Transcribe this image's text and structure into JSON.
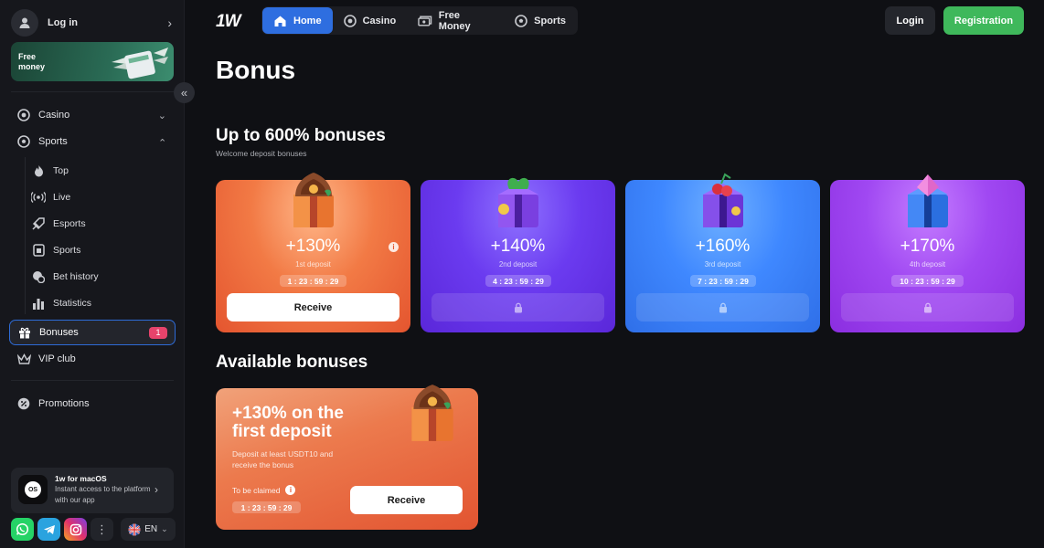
{
  "sidebar": {
    "login_label": "Log in",
    "free_money": "Free money",
    "nav": [
      {
        "label": "Casino",
        "icon": "casino-chip-icon"
      },
      {
        "label": "Sports",
        "icon": "soccer-ball-icon"
      }
    ],
    "sports_sub": [
      {
        "label": "Top",
        "icon": "fire-icon"
      },
      {
        "label": "Live",
        "icon": "broadcast-icon"
      },
      {
        "label": "Esports",
        "icon": "esports-icon"
      },
      {
        "label": "Sports",
        "icon": "sports-icon"
      },
      {
        "label": "Bet history",
        "icon": "bet-history-icon"
      },
      {
        "label": "Statistics",
        "icon": "bar-chart-icon"
      }
    ],
    "bonuses": {
      "label": "Bonuses",
      "badge": "1"
    },
    "vip": "VIP club",
    "promotions": "Promotions",
    "app_card": {
      "title": "1w for macOS",
      "desc": "Instant access to the platform with our app",
      "logo": "OS"
    },
    "language": "EN"
  },
  "topbar": {
    "logo": "1W",
    "tabs": [
      {
        "label": "Home",
        "icon": "home-icon",
        "active": true
      },
      {
        "label": "Casino",
        "icon": "casino-chip-icon",
        "active": false
      },
      {
        "label": "Free Money",
        "icon": "money-icon",
        "active": false
      },
      {
        "label": "Sports",
        "icon": "soccer-ball-icon",
        "active": false
      }
    ],
    "login": "Login",
    "registration": "Registration"
  },
  "main": {
    "title": "Bonus",
    "welcome": {
      "title": "Up to 600% bonuses",
      "subtitle": "Welcome deposit bonuses",
      "cards": [
        {
          "percent": "+130%",
          "deposit": "1st deposit",
          "timer": "1 : 23 : 59 : 29",
          "action": "Receive",
          "locked": false
        },
        {
          "percent": "+140%",
          "deposit": "2nd deposit",
          "timer": "4 : 23 : 59 : 29",
          "action": "",
          "locked": true
        },
        {
          "percent": "+160%",
          "deposit": "3rd deposit",
          "timer": "7 : 23 : 59 : 29",
          "action": "",
          "locked": true
        },
        {
          "percent": "+170%",
          "deposit": "4th deposit",
          "timer": "10 : 23 : 59 : 29",
          "action": "",
          "locked": true
        }
      ]
    },
    "available": {
      "title": "Available bonuses",
      "card": {
        "title": "+130% on the first deposit",
        "desc": "Deposit at least USDT10 and receive the bonus",
        "to_be_claimed": "To be claimed",
        "timer": "1 : 23 : 59 : 29",
        "action": "Receive"
      }
    }
  }
}
